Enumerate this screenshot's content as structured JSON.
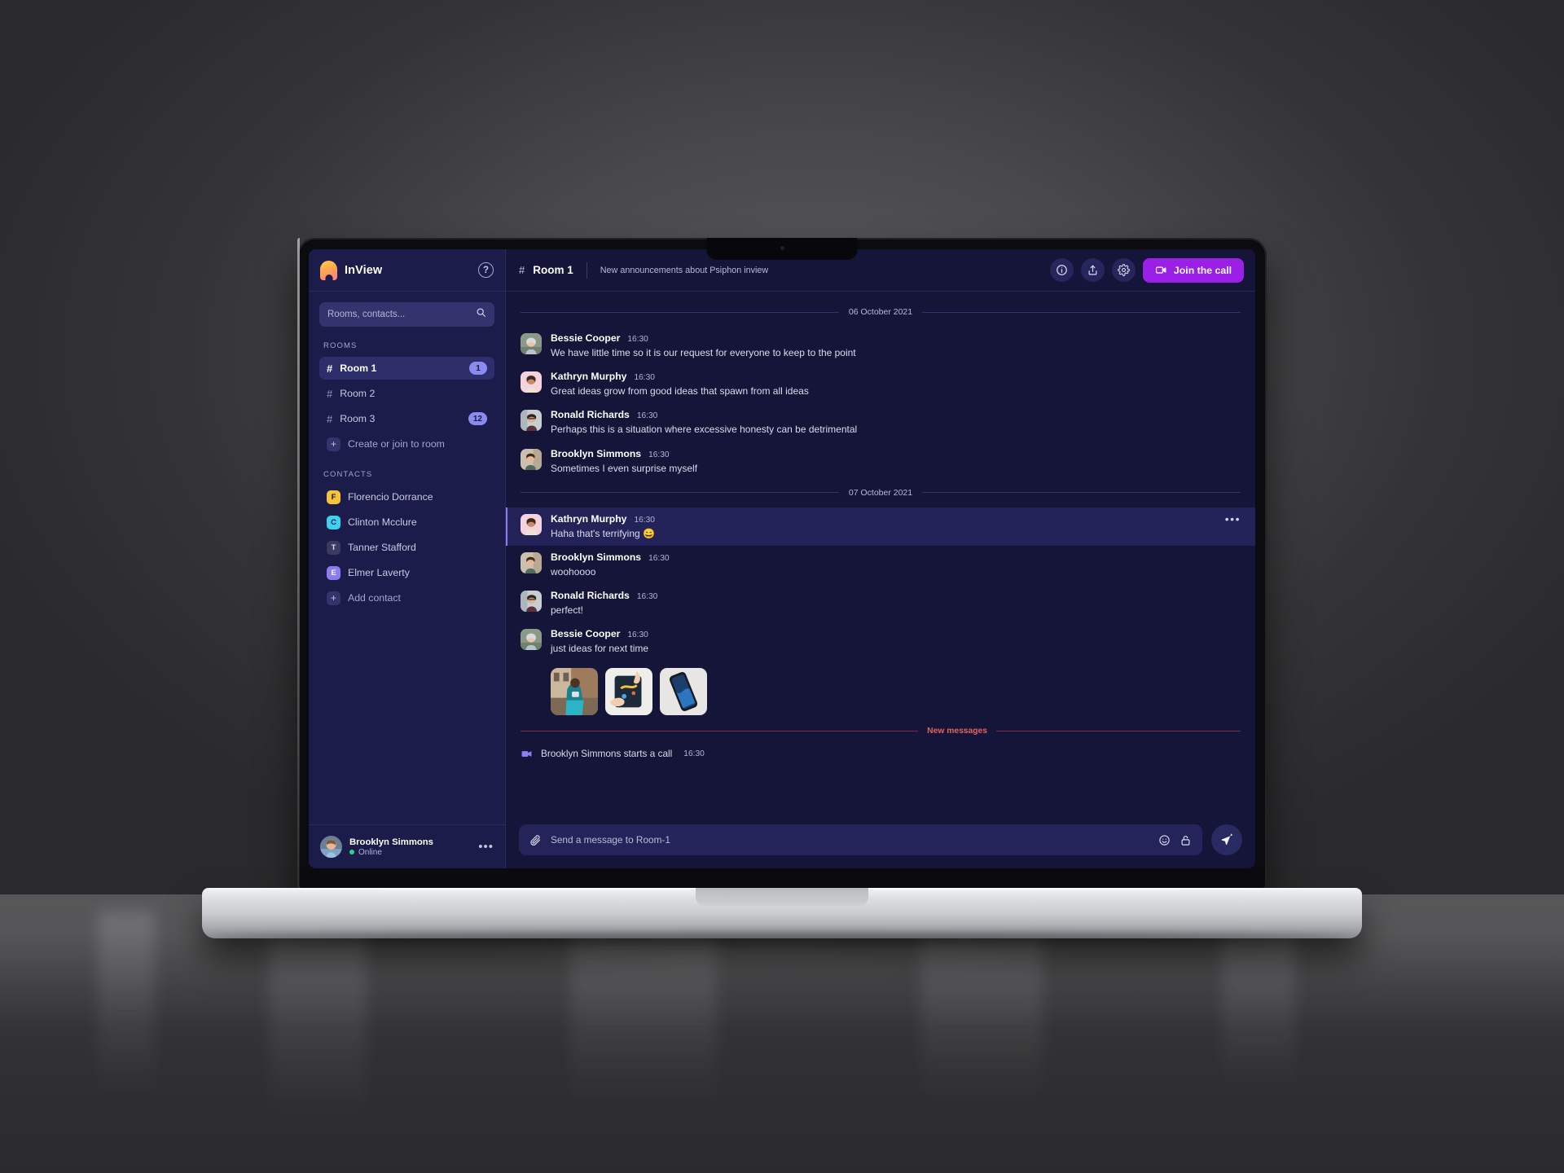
{
  "app": {
    "name": "InView",
    "logo_icon": "inview-arch-logo",
    "help_icon": "help-circle-icon"
  },
  "search": {
    "placeholder": "Rooms, contacts...",
    "value": "",
    "icon": "search-icon"
  },
  "sidebar": {
    "rooms_title": "ROOMS",
    "rooms": [
      {
        "label": "Room 1",
        "badge": "1",
        "active": true
      },
      {
        "label": "Room 2",
        "badge": "",
        "active": false
      },
      {
        "label": "Room 3",
        "badge": "12",
        "active": false
      }
    ],
    "create_room_label": "Create or join to room",
    "contacts_title": "CONTACTS",
    "contacts": [
      {
        "label": "Florencio Dorrance",
        "initial": "F",
        "color": "#f5c43c"
      },
      {
        "label": "Clinton Mcclure",
        "initial": "C",
        "color": "#3ed0f0"
      },
      {
        "label": "Tanner Stafford",
        "initial": "T",
        "color": "#3a3a62"
      },
      {
        "label": "Elmer Laverty",
        "initial": "E",
        "color": "#8d7bf0"
      }
    ],
    "add_contact_label": "Add contact"
  },
  "current_user": {
    "name": "Brooklyn Simmons",
    "status": "Online",
    "status_color": "#2fd47f",
    "menu_icon": "more-horizontal-icon"
  },
  "chat": {
    "room_hash": "#",
    "room_name": "Room 1",
    "topic": "New announcements about Psiphon inview",
    "actions": {
      "info_icon": "info-circle-icon",
      "share_icon": "share-upload-icon",
      "settings_icon": "gear-icon",
      "join_call_label": "Join the call",
      "join_call_icon": "video-camera-icon",
      "join_call_color": "#9c1fe8"
    },
    "days": [
      {
        "date": "06 October 2021",
        "messages": [
          {
            "author": "Bessie Cooper",
            "time": "16:30",
            "text": "We have little time so it is our request for everyone to keep to the point",
            "hovered": false
          },
          {
            "author": "Kathryn Murphy",
            "time": "16:30",
            "text": "Great ideas grow from good ideas that spawn from all ideas",
            "hovered": false
          },
          {
            "author": "Ronald Richards",
            "time": "16:30",
            "text": "Perhaps this is a situation where excessive honesty can be detrimental",
            "hovered": false
          },
          {
            "author": "Brooklyn Simmons",
            "time": "16:30",
            "text": "Sometimes I even surprise myself",
            "hovered": false
          }
        ]
      },
      {
        "date": "07 October 2021",
        "messages": [
          {
            "author": "Kathryn Murphy",
            "time": "16:30",
            "text": "Haha that's terrifying 😄",
            "hovered": true,
            "menu_icon": "more-horizontal-icon"
          },
          {
            "author": "Brooklyn Simmons",
            "time": "16:30",
            "text": "woohoooo",
            "hovered": false
          },
          {
            "author": "Ronald Richards",
            "time": "16:30",
            "text": "perfect!",
            "hovered": false
          },
          {
            "author": "Bessie Cooper",
            "time": "16:30",
            "text": "just ideas for next time",
            "hovered": false,
            "attachments": [
              "photo-man-with-phone",
              "photo-hands-on-tablet",
              "photo-phone-on-fabric"
            ]
          }
        ]
      }
    ],
    "new_messages_label": "New messages",
    "new_messages_color": "#e0655f",
    "call_event": {
      "text": "Brooklyn Simmons starts a call",
      "time": "16:30",
      "icon": "video-camera-icon"
    },
    "composer": {
      "attach_icon": "paperclip-icon",
      "placeholder": "Send a message to Room-1",
      "value": "",
      "emoji_icon": "smiley-icon",
      "lock_icon": "unlocked-padlock-icon",
      "send_icon": "paper-plane-send-icon"
    }
  }
}
